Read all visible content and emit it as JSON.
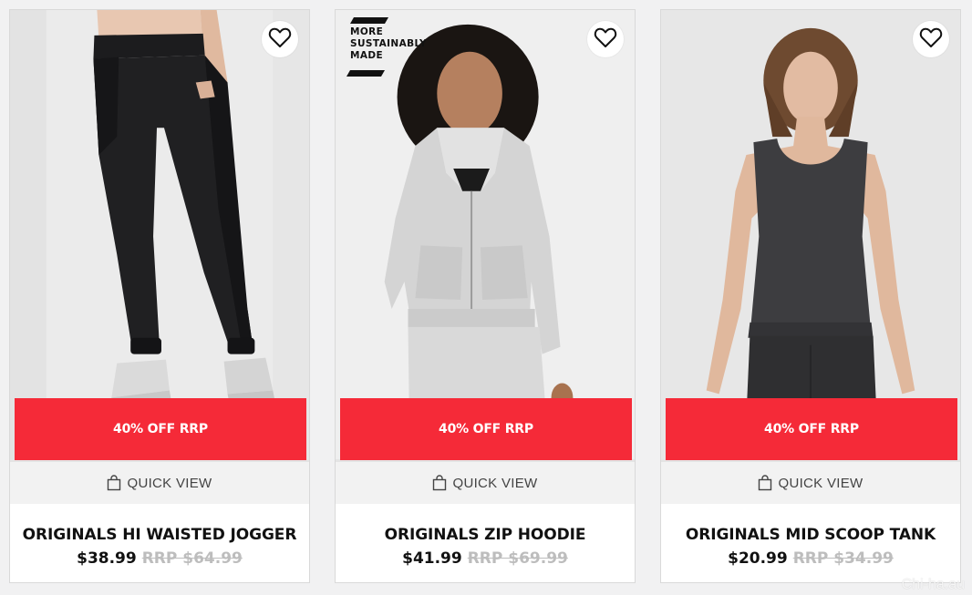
{
  "products": [
    {
      "promo_label": "40% OFF RRP",
      "quick_view_label": "QUICK VIEW",
      "name": "ORIGINALS HI WAISTED JOGGER",
      "price": "$38.99",
      "rrp": "RRP $64.99",
      "image_subject": "black jogger pants",
      "wishlist_icon": "heart-outline-icon"
    },
    {
      "promo_label": "40% OFF RRP",
      "quick_view_label": "QUICK VIEW",
      "name": "ORIGINALS ZIP HOODIE",
      "price": "$41.99",
      "rrp": "RRP $69.99",
      "image_subject": "grey zip hoodie",
      "wishlist_icon": "heart-outline-icon",
      "badge": "MORE SUSTAINABLY MADE"
    },
    {
      "promo_label": "40% OFF RRP",
      "quick_view_label": "QUICK VIEW",
      "name": "ORIGINALS MID SCOOP TANK",
      "price": "$20.99",
      "rrp": "RRP $34.99",
      "image_subject": "charcoal scoop tank",
      "wishlist_icon": "heart-outline-icon"
    }
  ],
  "watermark": "Chi-ha.au",
  "colors": {
    "promo": "#f52a38",
    "quick_view_bg": "#f2f2f2",
    "page_bg": "#f1f1f2",
    "rrp_text": "#bdbdbd"
  }
}
